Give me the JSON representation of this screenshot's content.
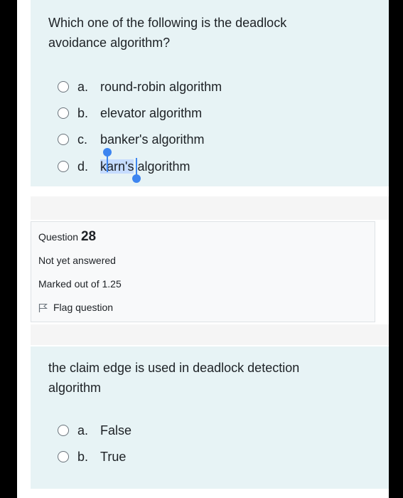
{
  "question1": {
    "text": "Which one of the following is the deadlock\navoidance algorithm?",
    "answers": [
      {
        "letter": "a.",
        "text": "round-robin algorithm"
      },
      {
        "letter": "b.",
        "text": "elevator algorithm"
      },
      {
        "letter": "c.",
        "text": "banker's algorithm"
      },
      {
        "letter": "d.",
        "text_highlighted": "karn's",
        "text_rest": " algorithm"
      }
    ]
  },
  "info": {
    "question_label": "Question",
    "question_number": "28",
    "status": "Not yet answered",
    "marks": "Marked out of 1.25",
    "flag_label": "Flag question"
  },
  "question2": {
    "text": "the claim edge is used in deadlock detection\nalgorithm",
    "answers": [
      {
        "letter": "a.",
        "text": "False"
      },
      {
        "letter": "b.",
        "text": "True"
      }
    ]
  },
  "colors": {
    "card_bg": "#e7f3f5",
    "selection": "#c6dcff",
    "selection_handle": "#3d85f0"
  }
}
